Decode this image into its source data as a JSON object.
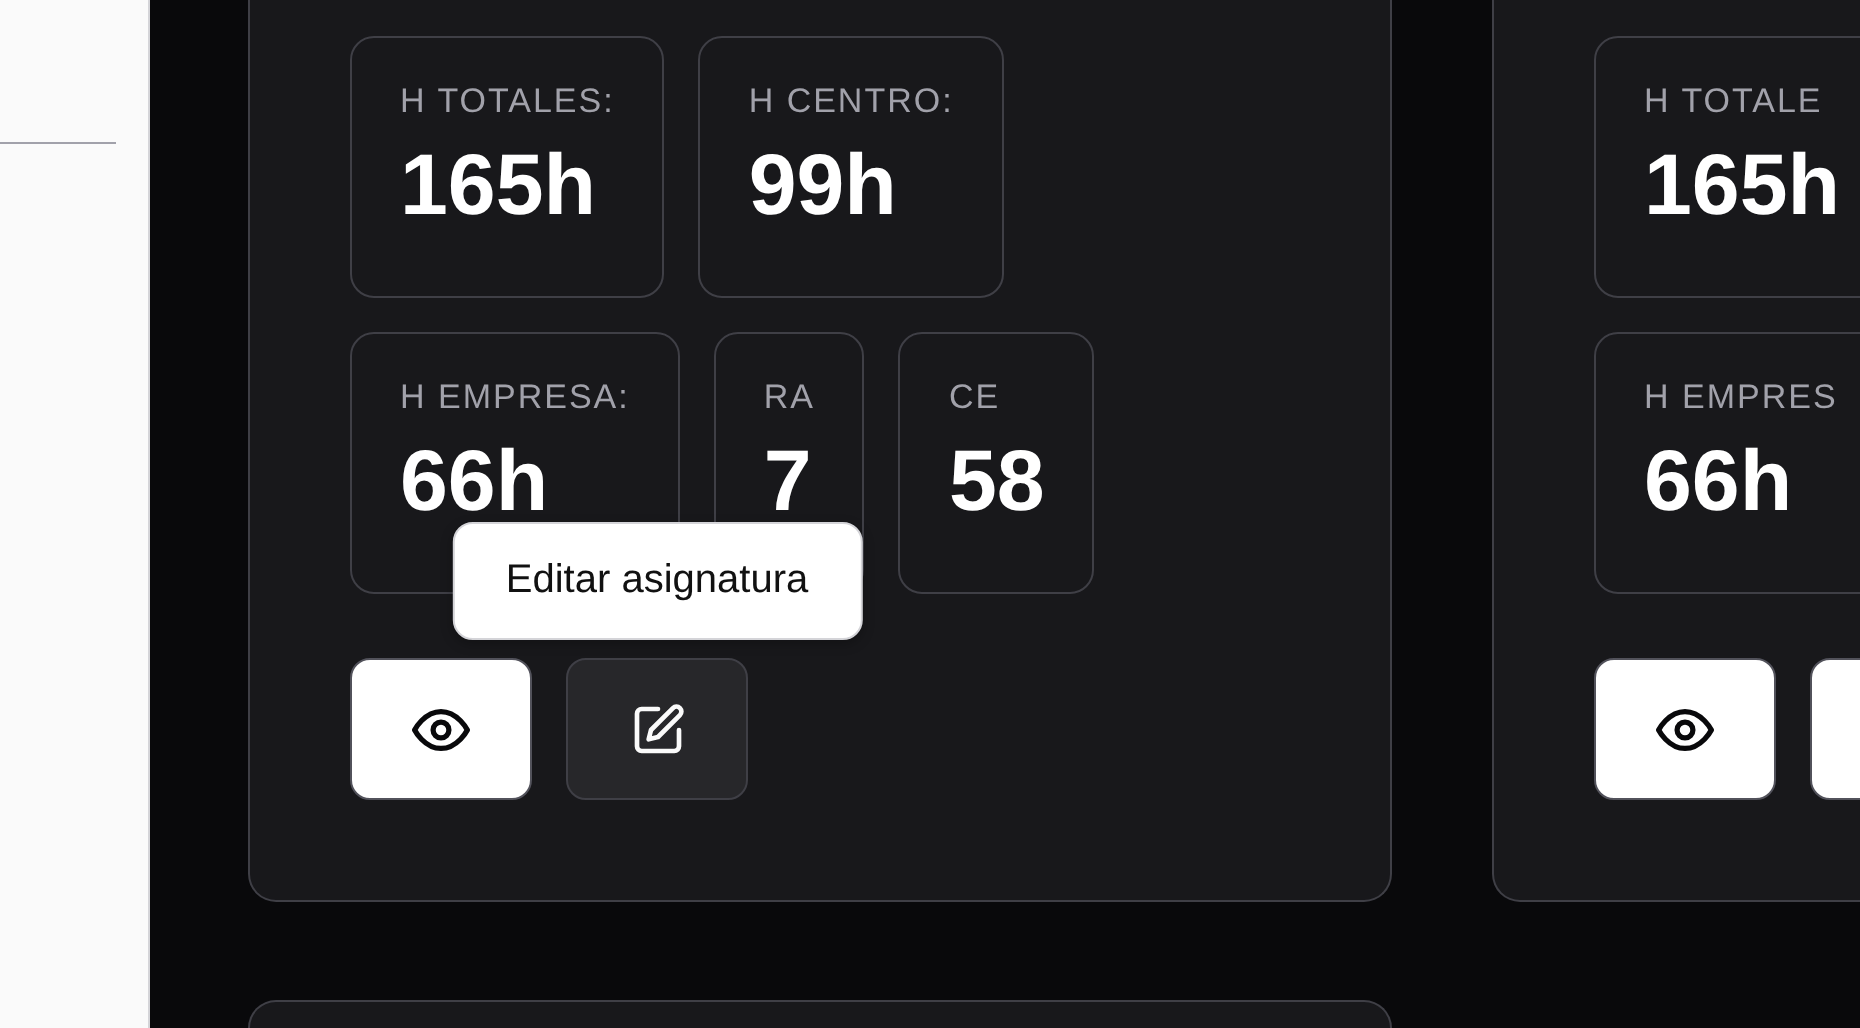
{
  "cards": [
    {
      "stat_rows": [
        [
          {
            "label": "H TOTALES:",
            "value": "165h"
          },
          {
            "label": "H CENTRO:",
            "value": "99h"
          }
        ],
        [
          {
            "label": "H EMPRESA:",
            "value": "66h"
          },
          {
            "label": "RA",
            "value": "7"
          },
          {
            "label": "CE",
            "value": "58"
          }
        ]
      ],
      "buttons": [
        {
          "kind": "view",
          "hovered": false
        },
        {
          "kind": "edit",
          "hovered": true,
          "tooltip": "Editar asignatura"
        }
      ]
    },
    {
      "stat_rows": [
        [
          {
            "label": "H TOTALE",
            "value": "165h"
          }
        ],
        [
          {
            "label": "H EMPRES",
            "value": "66h"
          }
        ]
      ],
      "buttons": [
        {
          "kind": "view",
          "hovered": false
        },
        {
          "kind": "blank",
          "hovered": false
        }
      ]
    }
  ]
}
